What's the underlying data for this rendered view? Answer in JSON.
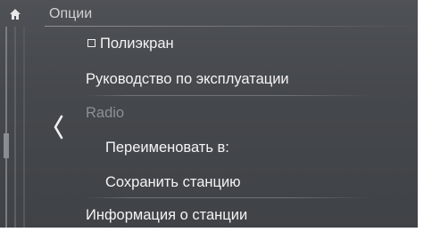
{
  "header": {
    "title": "Опции",
    "home_icon": "home-icon"
  },
  "menu": {
    "items": [
      {
        "label": "Полиэкран",
        "type": "checkbox",
        "checked": false,
        "enabled": true
      },
      {
        "label": "Руководство по эксплуатации",
        "enabled": true
      },
      {
        "label": "Radio",
        "enabled": false
      },
      {
        "label": "Переименовать в:",
        "enabled": true
      },
      {
        "label": "Сохранить станцию",
        "enabled": true
      },
      {
        "label": "Информация о станции",
        "enabled": true
      }
    ]
  },
  "nav": {
    "back_icon": "chevron-left-icon"
  },
  "colors": {
    "background": "#45484c",
    "text": "#f4f4f4",
    "disabled_text": "#8d9094",
    "header_text": "#cfd1d3"
  }
}
